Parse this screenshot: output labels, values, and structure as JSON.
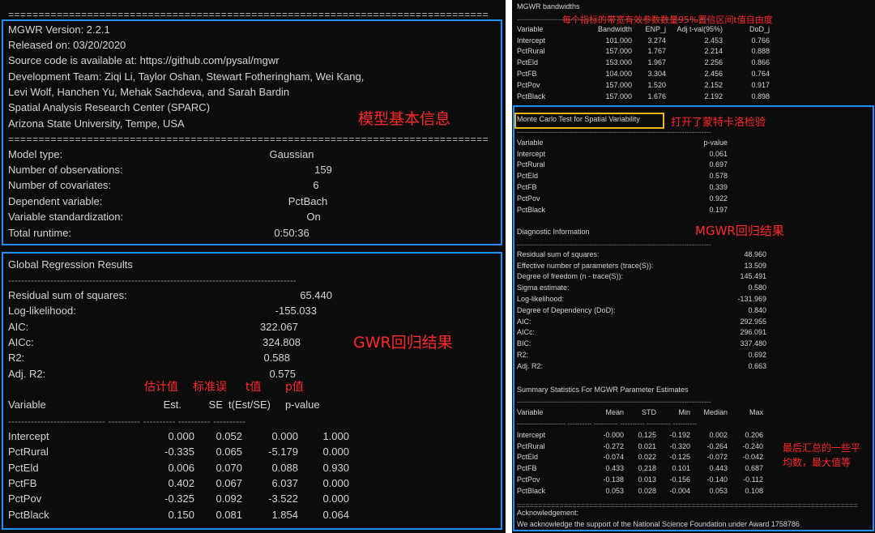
{
  "left": {
    "sep_eq": "===============================================================================",
    "dash_line": "-----------------------------------------------------------------------------------------",
    "info_lines": [
      "MGWR Version: 2.2.1",
      "Released on: 03/20/2020",
      "Source code is available at: https://github.com/pysal/mgwr",
      "Development Team: Ziqi Li, Taylor Oshan, Stewart Fotheringham, Wei Kang,",
      "Levi Wolf, Hanchen Yu, Mehak Sachdeva, and Sarah Bardin",
      "Spatial Analysis Research Center (SPARC)",
      "Arizona State University, Tempe, USA"
    ],
    "model_rows": [
      {
        "label": "Model type:",
        "value": "Gaussian"
      },
      {
        "label": "Number of observations:",
        "value": "159"
      },
      {
        "label": "Number of covariates:",
        "value": "6"
      },
      {
        "label": "Dependent variable:",
        "value": "PctBach"
      },
      {
        "label": "Variable standardization:",
        "value": "On"
      },
      {
        "label": "Total runtime:",
        "value": "0:50:36"
      }
    ],
    "global_title": "Global Regression Results",
    "global_rows": [
      {
        "label": "Residual sum of squares:",
        "value": "65.440"
      },
      {
        "label": "Log-likelihood:",
        "value": "-155.033"
      },
      {
        "label": "AIC:",
        "value": "322.067"
      },
      {
        "label": "AICc:",
        "value": "324.808"
      },
      {
        "label": "R2:",
        "value": "0.588"
      },
      {
        "label": "Adj. R2:",
        "value": "0.575"
      }
    ],
    "coef_header": [
      "Variable",
      "Est.",
      "SE",
      "t(Est/SE)",
      "p-value"
    ],
    "coef_dash": "------------------------------ ---------- ---------- ---------- ----------",
    "coef_rows": [
      [
        "Intercept",
        "0.000",
        "0.052",
        "0.000",
        "1.000"
      ],
      [
        "PctRural",
        "-0.335",
        "0.065",
        "-5.179",
        "0.000"
      ],
      [
        "PctEld",
        "0.006",
        "0.070",
        "0.088",
        "0.930"
      ],
      [
        "PctFB",
        "0.402",
        "0.067",
        "6.037",
        "0.000"
      ],
      [
        "PctPov",
        "-0.325",
        "0.092",
        "-3.522",
        "0.000"
      ],
      [
        "PctBlack",
        "0.150",
        "0.081",
        "1.854",
        "0.064"
      ]
    ],
    "notes": {
      "basic_info": "模型基本信息",
      "gwr_result": "GWR回归结果",
      "col_est": "估计值",
      "col_se": "标准误",
      "col_t": "t值",
      "col_p": "p值"
    }
  },
  "right": {
    "bw_title": "MGWR bandwidths",
    "bw_dash": "--------------------------------------------------------------------------------",
    "bw_header": [
      "Variable",
      "Bandwidth",
      "ENP_j",
      "Adj t-val(95%)",
      "DoD_j"
    ],
    "bw_rows": [
      [
        "Intercept",
        "101.000",
        "3.274",
        "2.453",
        "0.766"
      ],
      [
        "PctRural",
        "157.000",
        "1.767",
        "2.214",
        "0.888"
      ],
      [
        "PctEld",
        "153.000",
        "1.967",
        "2.256",
        "0.866"
      ],
      [
        "PctFB",
        "104.000",
        "3.304",
        "2.456",
        "0.764"
      ],
      [
        "PctPov",
        "157.000",
        "1.520",
        "2.152",
        "0.917"
      ],
      [
        "PctBlack",
        "157.000",
        "1.676",
        "2.192",
        "0.898"
      ]
    ],
    "mc_title": "Monte Carlo Test for Spatial Variability",
    "mc_dash": "--------------------------------------------------------------------------------",
    "mc_header": [
      "Variable",
      "p-value"
    ],
    "mc_rows": [
      [
        "Intercept",
        "0.061"
      ],
      [
        "PctRural",
        "0.697"
      ],
      [
        "PctEld",
        "0.578"
      ],
      [
        "PctFB",
        "0.339"
      ],
      [
        "PctPov",
        "0.922"
      ],
      [
        "PctBlack",
        "0.197"
      ]
    ],
    "diag_title": "Diagnostic Information",
    "diag_dash": "--------------------------------------------------------------------------------",
    "diag_rows": [
      {
        "label": "Residual sum of squares:",
        "value": "48.960"
      },
      {
        "label": "Effective number of parameters (trace(S)):",
        "value": "13.509"
      },
      {
        "label": "Degree of freedom (n - trace(S)):",
        "value": "145.491"
      },
      {
        "label": "Sigma estimate:",
        "value": "0.580"
      },
      {
        "label": "Log-likelihood:",
        "value": "-131.969"
      },
      {
        "label": "Degree of Dependency (DoD):",
        "value": "0.840"
      },
      {
        "label": "AIC:",
        "value": "292.955"
      },
      {
        "label": "AICc:",
        "value": "296.091"
      },
      {
        "label": "BIC:",
        "value": "337.480"
      },
      {
        "label": "R2:",
        "value": "0.692"
      },
      {
        "label": "Adj. R2:",
        "value": "0.663"
      }
    ],
    "sum_title": "Summary Statistics For MGWR Parameter Estimates",
    "sum_dash": "--------------------------------------------------------------------------------",
    "sum_header": [
      "Variable",
      "Mean",
      "STD",
      "Min",
      "Median",
      "Max"
    ],
    "sum_subdash": "-------------------- ---------- ---------- ---------- ---------- ----------",
    "sum_rows": [
      [
        "Intercept",
        "-0.000",
        "0.125",
        "-0.192",
        "0.002",
        "0.206"
      ],
      [
        "PctRural",
        "-0.272",
        "0.021",
        "-0.320",
        "-0.264",
        "-0.240"
      ],
      [
        "PctEld",
        "-0.074",
        "0.022",
        "-0.125",
        "-0.072",
        "-0.042"
      ],
      [
        "PctFB",
        "0.433",
        "0.218",
        "0.101",
        "0.443",
        "0.687"
      ],
      [
        "PctPov",
        "-0.138",
        "0.013",
        "-0.156",
        "-0.140",
        "-0.112"
      ],
      [
        "PctBlack",
        "0.053",
        "0.028",
        "-0.004",
        "0.053",
        "0.108"
      ]
    ],
    "ack_eq": "================================================================================",
    "ack_title": "Acknowledgement:",
    "ack_text": "We acknowledge the support of the National Science Foundation under Award 1758786",
    "notes": {
      "bw_note": "每个指标的带宽有效参数数量95%置信区间t值自由度",
      "mc_note": "打开了蒙特卡洛检验",
      "mgwr_note": "MGWR回归结果",
      "summary_note_1": "最后汇总的一些平",
      "summary_note_2": "均数，最大值等"
    }
  }
}
